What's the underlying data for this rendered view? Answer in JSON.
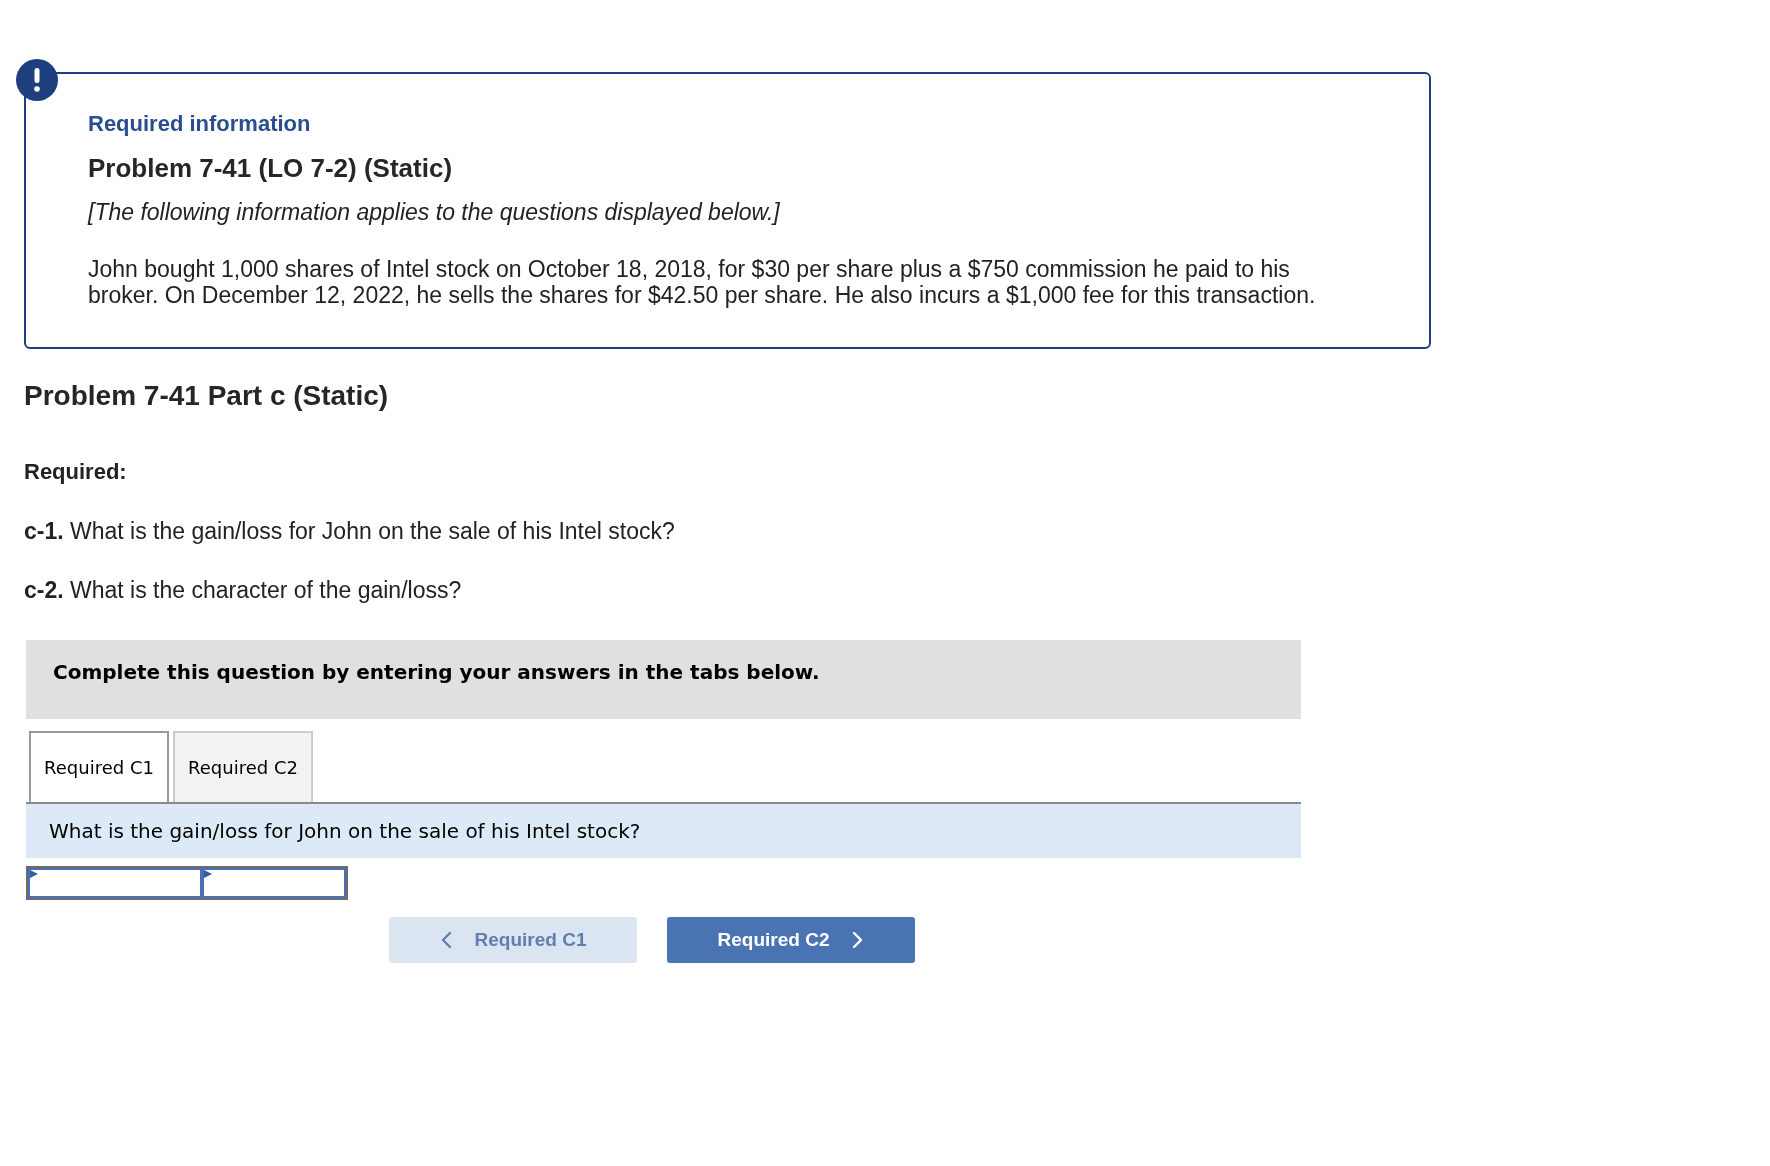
{
  "alert": {
    "label": "Required information",
    "title": "Problem 7-41 (LO 7-2) (Static)",
    "note": "[The following information applies to the questions displayed below.]",
    "body": "John bought 1,000 shares of Intel stock on October 18, 2018, for $30 per share plus a $750 commission he paid to his broker. On December 12, 2022, he sells the shares for $42.50 per share. He also incurs a $1,000 fee for this transaction."
  },
  "part": {
    "title": "Problem 7-41 Part c (Static)",
    "required_label": "Required:",
    "questions": [
      "**c-1.** What is the gain/loss for John on the sale of his Intel stock?",
      "**c-2.** What is the character of the gain/loss?"
    ]
  },
  "instructions": "Complete this question by entering your answers in the tabs below.",
  "tabs": [
    {
      "label": "Required C1",
      "selected": true
    },
    {
      "label": "Required C2",
      "selected": false
    }
  ],
  "question_bar": "What is the gain/loss for John on the sale of his Intel stock?",
  "answer_fields": [
    {
      "kind": "text_input"
    },
    {
      "kind": "text_input"
    }
  ],
  "buttons": [
    {
      "label": "Required C1",
      "kind": "previous",
      "disabled": true
    },
    {
      "label": "Required C2",
      "kind": "next",
      "disabled": false
    }
  ]
}
